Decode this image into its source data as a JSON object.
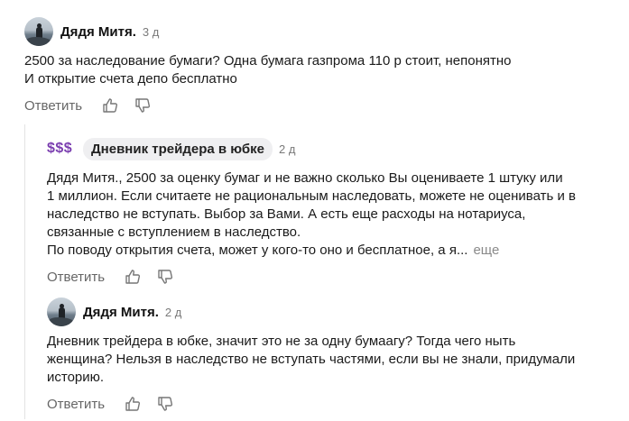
{
  "comments": [
    {
      "author": "Дядя Митя.",
      "time": "3 д",
      "lines": [
        "2500 за наследование бумаги? Одна бумага газпрома 110 р стоит, непонятно",
        "И открытие счета депо бесплатно"
      ],
      "reply_label": "Ответить"
    },
    {
      "avatar_text": "$$$",
      "author": "Дневник трейдера в юбке",
      "time": "2 д",
      "lines": [
        "Дядя Митя., 2500 за оценку бумаг и не важно сколько Вы оцениваете 1 штуку или",
        "1 миллион. Если считаете не рациональным наследовать, можете не оценивать и в",
        "наследство не вступать. Выбор за Вами. А есть еще расходы на нотариуса,",
        "связанные с вступлением в наследство.",
        "По поводу открытия счета, может у кого-то оно и бесплатное, а я..."
      ],
      "more_label": "еще",
      "reply_label": "Ответить"
    },
    {
      "author": "Дядя Митя.",
      "time": "2 д",
      "lines": [
        "Дневник трейдера в юбке, значит это не за одну бумаагу? Тогда чего ныть",
        "женщина? Нельзя в наследство не вступать частями, если вы не знали, придумали",
        "историю."
      ],
      "reply_label": "Ответить"
    }
  ],
  "icons": {
    "like": "thumbs-up-icon",
    "dislike": "thumbs-down-icon"
  },
  "colors": {
    "sss": "#7b3fb0",
    "muted": "#7a7a7a",
    "pill_bg": "#efeff1"
  }
}
